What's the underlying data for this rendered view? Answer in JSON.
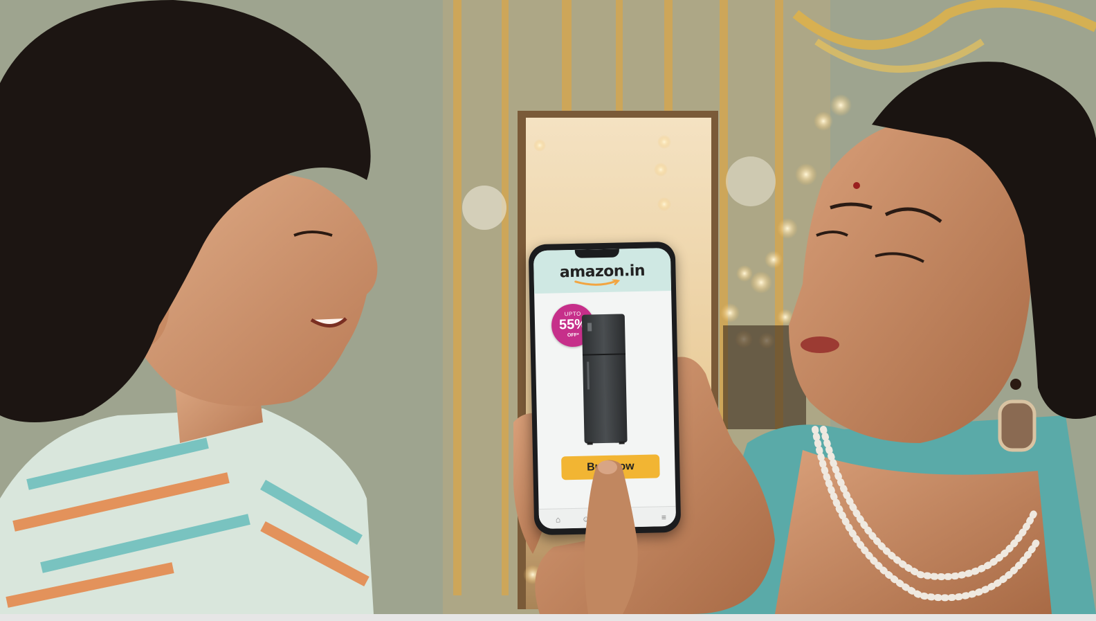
{
  "phone_app": {
    "logo_text": "amazon.in",
    "badge": {
      "top": "UPTO",
      "value": "55%",
      "bottom": "OFF*"
    },
    "buy_button_label": "Buy Now",
    "nav_icons": [
      "home-icon",
      "user-icon",
      "menu-icon"
    ]
  },
  "colors": {
    "header_bg": "#cfe8e3",
    "badge_bg": "#c62f8a",
    "buy_button_bg": "#f2b533",
    "smile_arrow": "#f2a541"
  }
}
